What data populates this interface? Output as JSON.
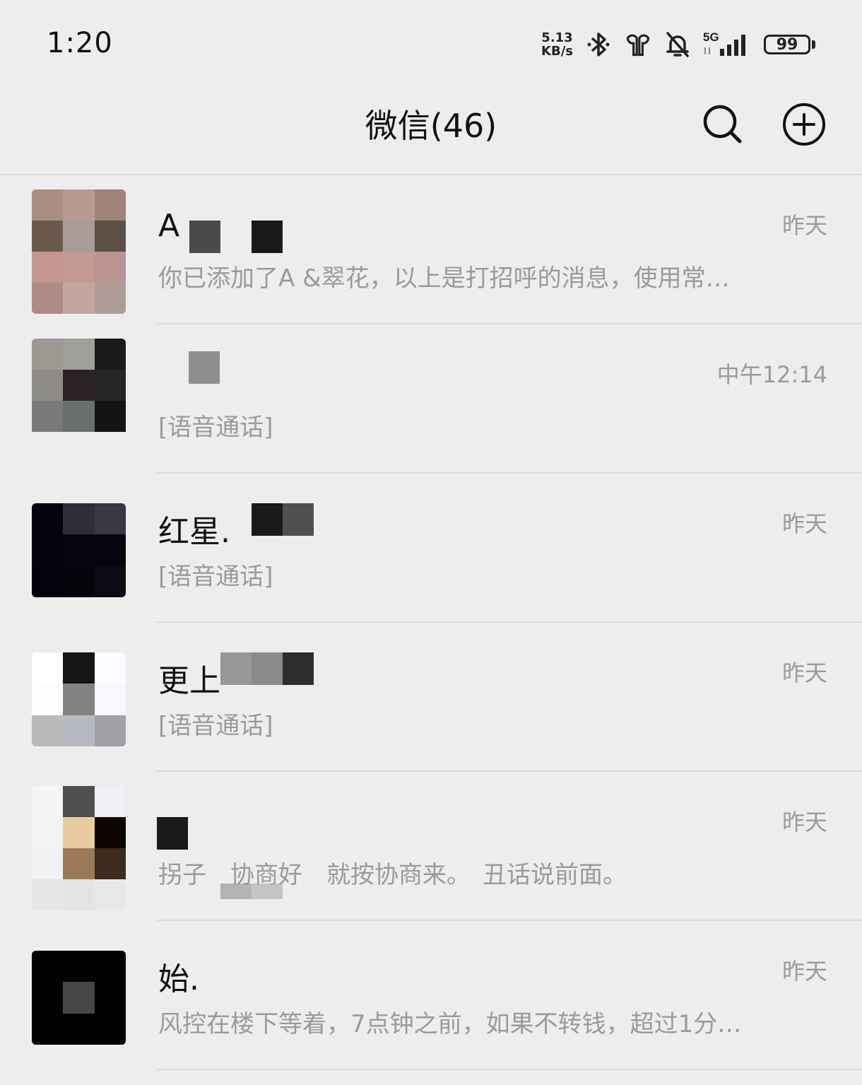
{
  "status_bar": {
    "time": "1:20",
    "net_speed_value": "5.13",
    "net_speed_unit": "KB/s",
    "network": "5G",
    "battery": "99",
    "icons": [
      "bluetooth-icon",
      "earbuds-icon",
      "bell-muted-icon",
      "signal-icon"
    ]
  },
  "header": {
    "title": "微信(46)",
    "search_icon": "search-icon",
    "add_icon": "plus-circle-icon"
  },
  "chats": [
    {
      "name": "A",
      "time": "昨天",
      "preview": "你已添加了A &翠花，以上是打招呼的消息，使用常…"
    },
    {
      "name": "",
      "time": "中午12:14",
      "preview": "[语音通话]"
    },
    {
      "name": "红星.",
      "time": "昨天",
      "preview": "[语音通话]"
    },
    {
      "name": "更上",
      "time": "昨天",
      "preview": "[语音通话]"
    },
    {
      "name": "",
      "time": "昨天",
      "preview": "拐子　协商好　就按协商来。　丑话说前面。"
    },
    {
      "name": "始.",
      "time": "昨天",
      "preview": "风控在楼下等着，7点钟之前，如果不转钱，超过1分…"
    }
  ]
}
